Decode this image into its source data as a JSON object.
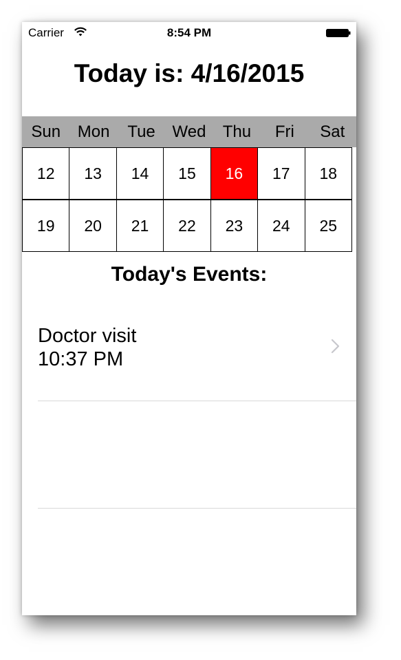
{
  "status_bar": {
    "carrier": "Carrier",
    "time": "8:54 PM",
    "icons": [
      "wifi-icon",
      "battery-icon"
    ]
  },
  "header": {
    "title": "Today is: 4/16/2015"
  },
  "calendar": {
    "weekdays": [
      "Sun",
      "Mon",
      "Tue",
      "Wed",
      "Thu",
      "Fri",
      "Sat"
    ],
    "weeks": [
      [
        "12",
        "13",
        "14",
        "15",
        "16",
        "17",
        "18"
      ],
      [
        "19",
        "20",
        "21",
        "22",
        "23",
        "24",
        "25"
      ]
    ],
    "selected_day": "16",
    "header_color": "#aaaaaa",
    "selected_color": "#ff0000"
  },
  "events": {
    "title": "Today's Events:",
    "items": [
      {
        "name": "Doctor visit",
        "time": "10:37 PM",
        "accessory": "chevron-right-icon"
      }
    ]
  }
}
